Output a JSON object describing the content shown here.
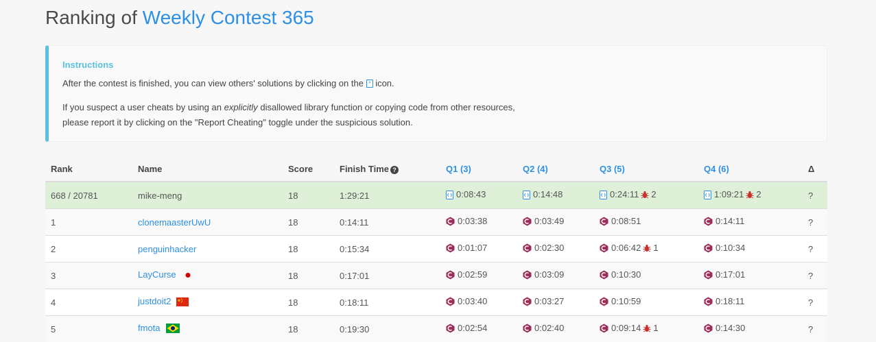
{
  "title": {
    "prefix": "Ranking of",
    "contest": "Weekly Contest 365"
  },
  "instructions": {
    "heading": "Instructions",
    "line1_before": "After the contest is finished, you can view others' solutions by clicking on the",
    "line1_after": "icon.",
    "line2_before": "If you suspect a user cheats by using an",
    "line2_em": "explicitly",
    "line2_after": "disallowed library function or copying code from other resources,",
    "line3": "please report it by clicking on the \"Report Cheating\" toggle under the suspicious solution."
  },
  "table": {
    "headers": {
      "rank": "Rank",
      "name": "Name",
      "score": "Score",
      "finish_time": "Finish Time",
      "q1": "Q1 (3)",
      "q2": "Q2 (4)",
      "q3": "Q3 (5)",
      "q4": "Q4 (6)",
      "delta": "Δ"
    },
    "rows": [
      {
        "rank": "668 / 20781",
        "name": "mike-meng",
        "score": "18",
        "finish": "1:29:21",
        "q1": "0:08:43",
        "q2": "0:14:48",
        "q3": "0:24:11",
        "q3_bugs": "2",
        "q4": "1:09:21",
        "q4_bugs": "2",
        "delta": "?"
      },
      {
        "rank": "1",
        "name": "clonemaasterUwU",
        "score": "18",
        "finish": "0:14:11",
        "q1": "0:03:38",
        "q2": "0:03:49",
        "q3": "0:08:51",
        "q4": "0:14:11",
        "delta": "?"
      },
      {
        "rank": "2",
        "name": "penguinhacker",
        "score": "18",
        "finish": "0:15:34",
        "q1": "0:01:07",
        "q2": "0:02:30",
        "q3": "0:06:42",
        "q3_bugs": "1",
        "q4": "0:10:34",
        "delta": "?"
      },
      {
        "rank": "3",
        "name": "LayCurse",
        "score": "18",
        "finish": "0:17:01",
        "q1": "0:02:59",
        "q2": "0:03:09",
        "q3": "0:10:30",
        "q4": "0:17:01",
        "delta": "?"
      },
      {
        "rank": "4",
        "name": "justdoit2",
        "score": "18",
        "finish": "0:18:11",
        "q1": "0:03:40",
        "q2": "0:03:27",
        "q3": "0:10:59",
        "q4": "0:18:11",
        "delta": "?"
      },
      {
        "rank": "5",
        "name": "fmota",
        "score": "18",
        "finish": "0:19:30",
        "q1": "0:02:54",
        "q2": "0:02:40",
        "q3": "0:09:14",
        "q3_bugs": "1",
        "q4": "0:14:30",
        "delta": "?"
      }
    ]
  },
  "colors": {
    "link": "#2d8fe6",
    "self_row": "#dff0d8",
    "info_accent": "#5bc0de",
    "bug": "#c9302c",
    "cpp_logo": "#9c2d5a"
  },
  "icons": {
    "solution": "code-file-icon",
    "language": "cpp-logo-icon",
    "penalty": "bug-icon",
    "help": "question-circle-icon",
    "flags": [
      "japan-flag-icon",
      "china-flag-icon",
      "brazil-flag-icon"
    ]
  }
}
